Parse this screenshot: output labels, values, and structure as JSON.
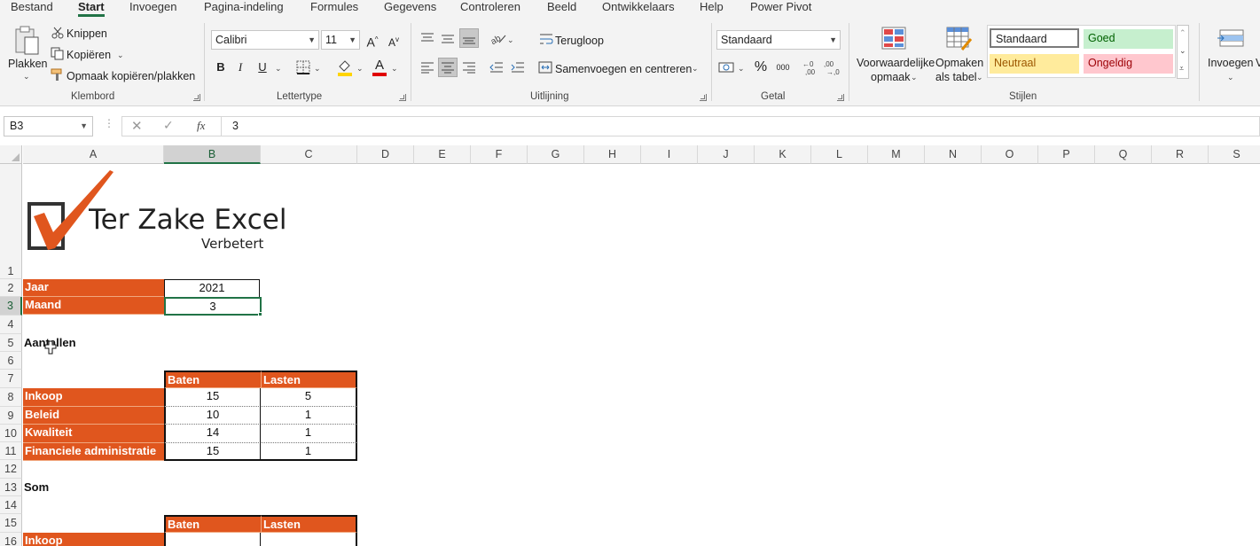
{
  "tabs": [
    "Bestand",
    "Start",
    "Invoegen",
    "Pagina-indeling",
    "Formules",
    "Gegevens",
    "Controleren",
    "Beeld",
    "Ontwikkelaars",
    "Help",
    "Power Pivot"
  ],
  "active_tab": "Start",
  "ribbon": {
    "klembord": {
      "label": "Klembord",
      "plakken": "Plakken",
      "knippen": "Knippen",
      "kopieren": "Kopiëren",
      "opmaak": "Opmaak kopiëren/plakken"
    },
    "lettertype": {
      "label": "Lettertype",
      "font": "Calibri",
      "size": "11",
      "bold": "B",
      "italic": "I",
      "underline": "U"
    },
    "uitlijning": {
      "label": "Uitlijning",
      "terugloop": "Terugloop",
      "samenvoegen": "Samenvoegen en centreren"
    },
    "getal": {
      "label": "Getal",
      "format": "Standaard"
    },
    "stijlen": {
      "label": "Stijlen",
      "voorwaardelijke": [
        "Voorwaardelijke",
        "opmaak"
      ],
      "opmaken": [
        "Opmaken",
        "als tabel"
      ],
      "styles": [
        {
          "name": "Standaard",
          "bg": "#ffffff",
          "fg": "#222222"
        },
        {
          "name": "Goed",
          "bg": "#c6efce",
          "fg": "#006100"
        },
        {
          "name": "Neutraal",
          "bg": "#ffeb9c",
          "fg": "#9c5700"
        },
        {
          "name": "Ongeldig",
          "bg": "#ffc7ce",
          "fg": "#9c0006"
        }
      ]
    },
    "cellen": {
      "invoegen": "Invoegen"
    }
  },
  "formula_bar": {
    "name_box": "B3",
    "formula": "3"
  },
  "columns": [
    "A",
    "B",
    "C",
    "D",
    "E",
    "F",
    "G",
    "H",
    "I",
    "J",
    "K",
    "L",
    "M",
    "N",
    "O",
    "P",
    "Q",
    "R",
    "S"
  ],
  "rows": [
    "1",
    "2",
    "3",
    "4",
    "5",
    "6",
    "7",
    "8",
    "9",
    "10",
    "11",
    "12",
    "13",
    "14",
    "15",
    "16"
  ],
  "logo": {
    "title": "Ter Zake Excel",
    "subtitle": "Verbetert"
  },
  "sheet": {
    "jaar_label": "Jaar",
    "jaar_value": "2021",
    "maand_label": "Maand",
    "maand_value": "3",
    "section1_title": "Aantallen",
    "section2_title": "Som",
    "header_baten": "Baten",
    "header_lasten": "Lasten",
    "table1": [
      {
        "label": "Inkoop",
        "baten": "15",
        "lasten": "5"
      },
      {
        "label": "Beleid",
        "baten": "10",
        "lasten": "1"
      },
      {
        "label": "Kwaliteit",
        "baten": "14",
        "lasten": "1"
      },
      {
        "label": "Financiele administratie",
        "baten": "15",
        "lasten": "1"
      }
    ],
    "table2_first_row": "Inkoop"
  },
  "accent_color": "#217346",
  "table_orange": "#e0561e"
}
